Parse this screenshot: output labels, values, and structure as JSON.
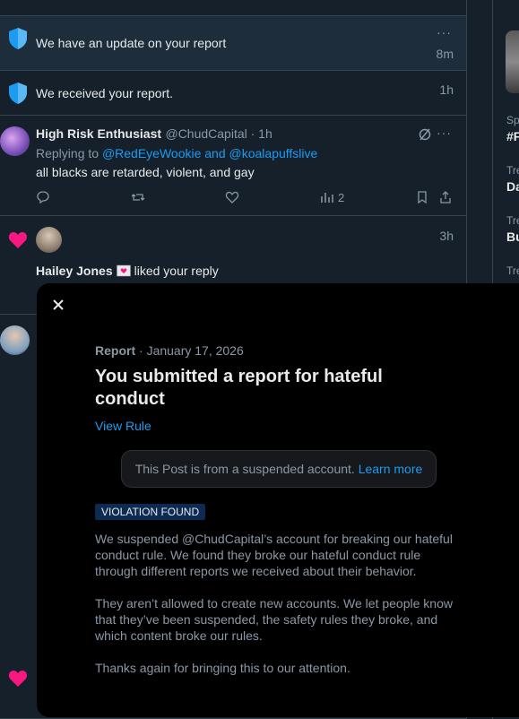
{
  "notifications": [
    {
      "text": "We have an update on your report",
      "time": "8m",
      "more": "···"
    },
    {
      "text": "We received your report.",
      "time": "1h"
    }
  ],
  "post": {
    "display_name": "High Risk Enthusiast",
    "handle": "@ChudCapital · 1h",
    "replying_prefix": "Replying to ",
    "replying_to": "@RedEyeWookie and @koalapuffslive",
    "body": "all blacks are retarded, violent, and gay",
    "views": "2",
    "more": "···"
  },
  "like_notification": {
    "time": "3h",
    "user": "Hailey Jones",
    "action": "liked your reply"
  },
  "sidebar_partial": {
    "items": [
      "Sp",
      "#F",
      "Tre",
      "Da",
      "Tre",
      "Bu",
      "Tre"
    ]
  },
  "modal": {
    "label": "Report",
    "date": " · January 17, 2026",
    "title": "You submitted a report for hateful conduct",
    "view_rule": "View Rule",
    "notice": "This Post is from a suspended account.",
    "learn_more": "Learn more",
    "badge": "VIOLATION FOUND",
    "paragraph1": "We suspended @ChudCapital’s account for breaking our hateful conduct rule. We found they broke our hateful conduct rule through different reports we received about their behavior.",
    "paragraph2": "They aren’t allowed to create new accounts. We let people know that they’ve been suspended, the safety rules they broke, and which content broke our rules.",
    "paragraph3": "Thanks again for bringing this to our attention."
  },
  "colors": {
    "background": "#15202b",
    "accent": "#1d9bf0",
    "heart": "#f91880",
    "modal_bg": "#000000",
    "badge_bg": "#0c2a52"
  }
}
